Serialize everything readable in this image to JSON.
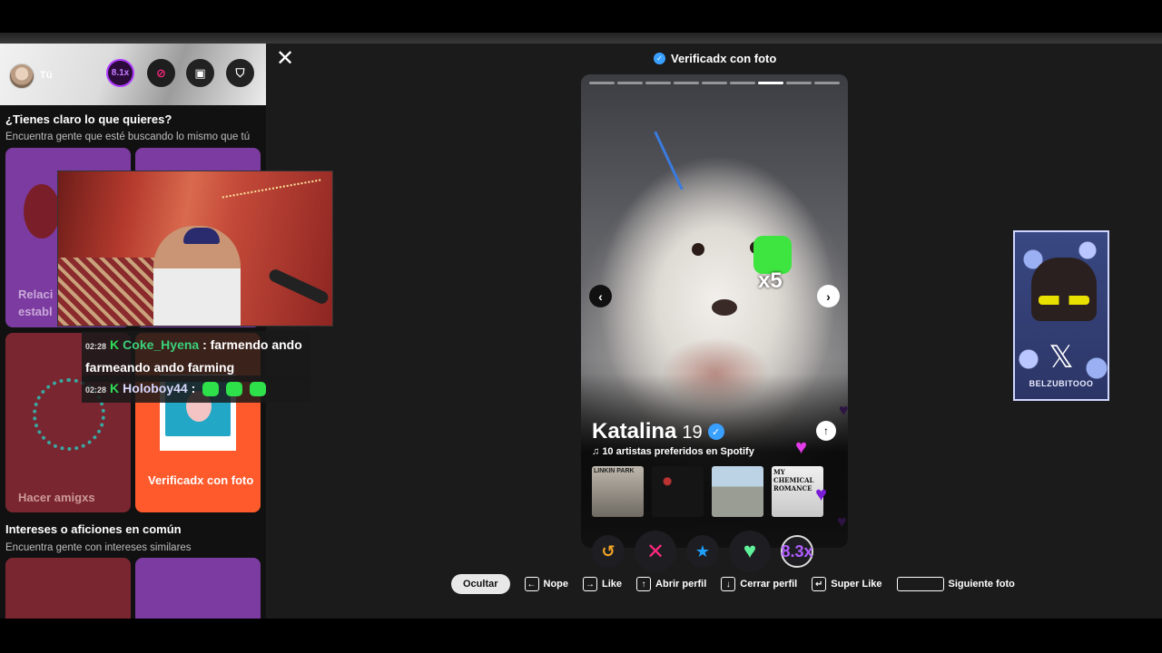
{
  "sidebar": {
    "user_label": "Tú",
    "boost_label": "8.1x",
    "section1": {
      "title": "¿Tienes claro lo que quieres?",
      "subtitle": "Encuentra gente que esté buscando lo mismo que tú"
    },
    "cards": [
      {
        "label": "Relaci\nestabl",
        "color": "#7c3ba0"
      },
      {
        "label": "Hacer amigxs",
        "color": "#7a2630"
      },
      {
        "label": "Verificadx con foto",
        "color": "#ff5a2c"
      }
    ],
    "section2": {
      "title": "Intereses o aficiones en común",
      "subtitle": "Encuentra gente con intereses similares"
    }
  },
  "chat": [
    {
      "time": "02:28",
      "badge": "K",
      "user": "Coke_Hyena",
      "message": ": farmendo ando farmeando ando farming"
    },
    {
      "time": "02:28",
      "badge": "K",
      "user": "Holoboy44",
      "message": ":"
    }
  ],
  "header": {
    "verified_label": "Verificadx con foto",
    "verified_icon": "check-badge-icon"
  },
  "profile": {
    "name": "Katalina",
    "age": "19",
    "spotify_label": "10 artistas preferidos en Spotify",
    "photo_count": 9,
    "active_photo": 7,
    "emote_multiplier": "x5",
    "albums": [
      {
        "label": "LINKIN PARK"
      },
      {
        "label": ""
      },
      {
        "label": ""
      },
      {
        "label": "MY CHEMICAL ROMANCE"
      }
    ]
  },
  "actions": {
    "rewind": "↺",
    "nope": "✕",
    "super": "★",
    "like": "♥",
    "boost": "8.3x"
  },
  "hints": {
    "hide": "Ocultar",
    "nope_key": "←",
    "nope": "Nope",
    "like_key": "→",
    "like": "Like",
    "open_key": "↑",
    "open": "Abrir perfil",
    "close_key": "↓",
    "close": "Cerrar perfil",
    "super_key": "↵",
    "super": "Super Like",
    "next": "Siguiente foto"
  },
  "sticker": {
    "x_logo": "𝕏",
    "handle": "BELZUBITOOO"
  },
  "colors": {
    "brand_pink": "#fd267d",
    "verified_blue": "#3aa0ff",
    "like_green": "#5ff29b",
    "boost_purple": "#b05cff"
  }
}
